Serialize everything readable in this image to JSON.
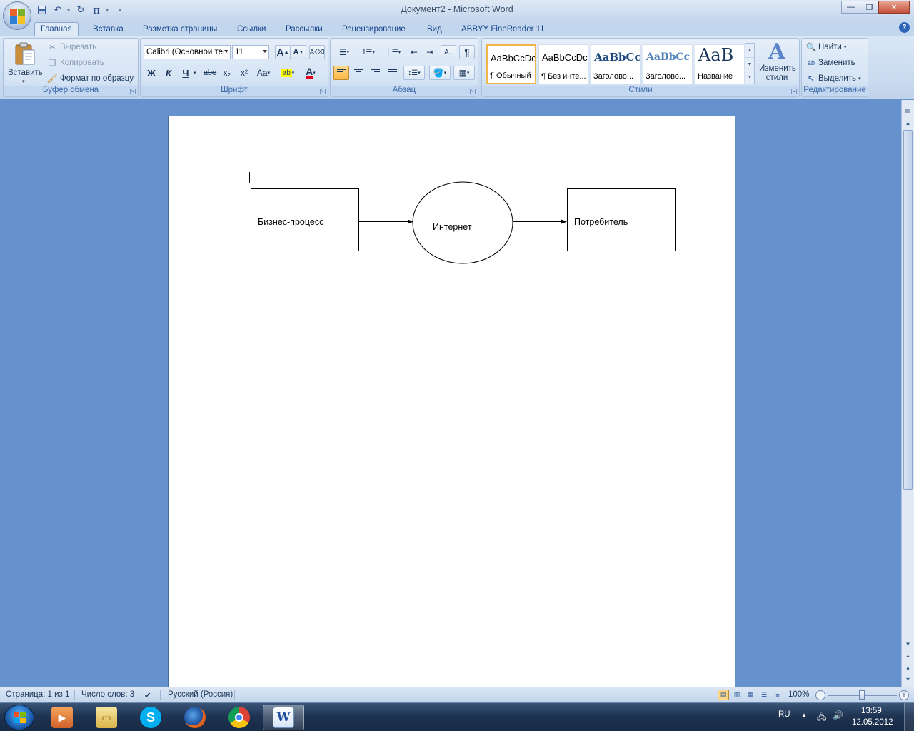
{
  "window": {
    "title": "Документ2 - Microsoft Word",
    "controls": {
      "minimize": "—",
      "maximize": "❐",
      "close": "✕"
    }
  },
  "tabs": [
    {
      "label": "Главная",
      "active": true
    },
    {
      "label": "Вставка"
    },
    {
      "label": "Разметка страницы"
    },
    {
      "label": "Ссылки"
    },
    {
      "label": "Рассылки"
    },
    {
      "label": "Рецензирование"
    },
    {
      "label": "Вид"
    },
    {
      "label": "ABBYY FineReader 11"
    }
  ],
  "ribbon": {
    "clipboard": {
      "label": "Буфер обмена",
      "paste": "Вставить",
      "cut": "Вырезать",
      "copy": "Копировать",
      "format_painter": "Формат по образцу"
    },
    "font": {
      "label": "Шрифт",
      "font_name": "Calibri (Основной текст)",
      "font_size": "11",
      "bold": "Ж",
      "italic": "К",
      "underline": "Ч",
      "strike": "abe",
      "subscript": "x₂",
      "superscript": "x²",
      "change_case": "Aa",
      "grow": "A",
      "shrink": "A"
    },
    "paragraph": {
      "label": "Абзац",
      "show_marks": "¶"
    },
    "styles": {
      "label": "Стили",
      "items": [
        {
          "sample": "AaBbCcDc",
          "name": "¶ Обычный",
          "selected": true
        },
        {
          "sample": "AaBbCcDc",
          "name": "¶ Без инте..."
        },
        {
          "sample": "AaBbCc",
          "name": "Заголово..."
        },
        {
          "sample": "AaBbCc",
          "name": "Заголово..."
        },
        {
          "sample": "AaB",
          "name": "Название"
        }
      ],
      "change_styles": "Изменить стили"
    },
    "editing": {
      "label": "Редактирование",
      "find": "Найти",
      "replace": "Заменить",
      "select": "Выделить"
    }
  },
  "document": {
    "diagram": {
      "box1": "Бизнес-процесс",
      "ellipse": "Интернет",
      "box2": "Потребитель"
    }
  },
  "status": {
    "page": "Страница: 1 из 1",
    "words": "Число слов: 3",
    "language": "Русский (Россия)",
    "zoom": "100%",
    "zoom_level_pct": 50
  },
  "taskbar": {
    "lang": "RU",
    "time": "13:59",
    "date": "12.05.2012"
  },
  "colors": {
    "accent": "#15428b",
    "workspace": "#6591cd",
    "selected_style_border": "#f0b54a"
  }
}
